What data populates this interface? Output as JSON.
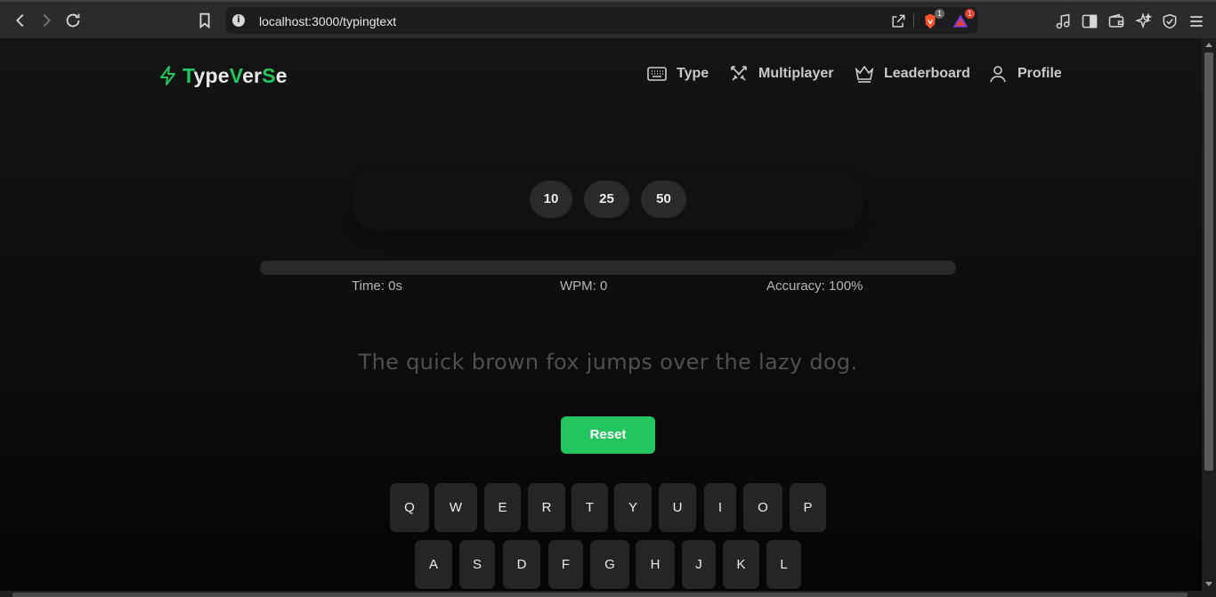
{
  "browser": {
    "url": "localhost:3000/typingtext",
    "brave_badge": "1",
    "rewards_badge": "1"
  },
  "site": {
    "logo": {
      "part1": "T",
      "part2": "ype",
      "part3": "V",
      "part4": "er",
      "part5": "S",
      "part6": "e"
    },
    "nav": {
      "type": "Type",
      "multiplayer": "Multiplayer",
      "leaderboard": "Leaderboard",
      "profile": "Profile"
    }
  },
  "typing": {
    "word_counts": [
      "10",
      "25",
      "50"
    ],
    "progress": 0,
    "stats": {
      "time": "Time: 0s",
      "wpm": "WPM: 0",
      "accuracy": "Accuracy: 100%"
    },
    "text": "The quick brown fox jumps over the lazy dog.",
    "reset_label": "Reset"
  },
  "keyboard": {
    "row1": [
      "Q",
      "W",
      "E",
      "R",
      "T",
      "Y",
      "U",
      "I",
      "O",
      "P"
    ],
    "row2": [
      "A",
      "S",
      "D",
      "F",
      "G",
      "H",
      "J",
      "K",
      "L"
    ]
  },
  "colors": {
    "accent": "#22c55e",
    "background": "#0e0e0e"
  }
}
